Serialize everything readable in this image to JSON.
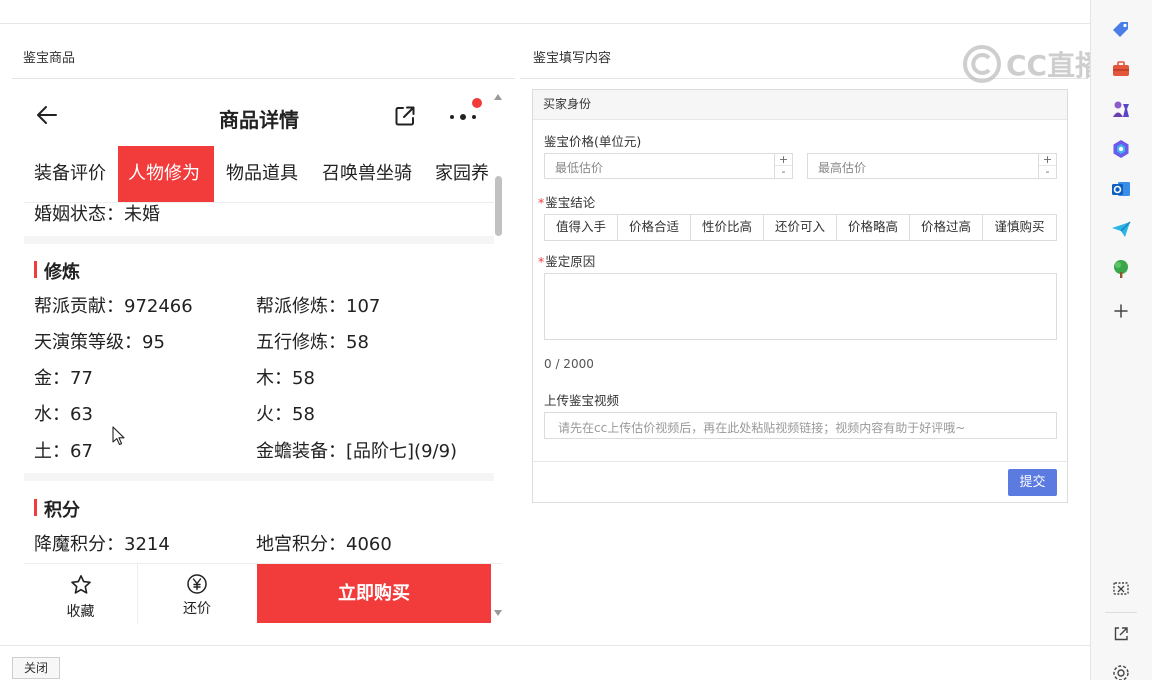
{
  "left_panel": {
    "section_title": "鉴宝商品",
    "nav": {
      "title": "商品详情"
    },
    "tabs": [
      {
        "label": "装备评价",
        "active": false
      },
      {
        "label": "人物修为",
        "active": true
      },
      {
        "label": "物品道具",
        "active": false
      },
      {
        "label": "召唤兽坐骑",
        "active": false
      },
      {
        "label": "家园养"
      }
    ],
    "marriage_status": "婚姻状态：未婚",
    "cultivation": {
      "title": "修炼",
      "rows": [
        [
          "帮派贡献：972466",
          "帮派修炼：107"
        ],
        [
          "天演策等级：95",
          "五行修炼：58"
        ],
        [
          "金：77",
          "木：58"
        ],
        [
          "水：63",
          "火：58"
        ],
        [
          "土：67",
          "金蟾装备：[品阶七](9/9)"
        ]
      ]
    },
    "points": {
      "title": "积分",
      "rows": [
        [
          "降魔积分：3214",
          "地宫积分：4060"
        ]
      ]
    },
    "bottom_bar": {
      "favorite_label": "收藏",
      "counter_offer_label": "还价",
      "buy_label": "立即购买"
    }
  },
  "right_panel": {
    "section_title": "鉴宝填写内容",
    "form_header": "买家身份",
    "price": {
      "label": "鉴宝价格(单位元)",
      "min_placeholder": "最低估价",
      "max_placeholder": "最高估价",
      "plus": "+",
      "minus": "-"
    },
    "conclusion": {
      "label": "鉴宝结论",
      "options": [
        "值得入手",
        "价格合适",
        "性价比高",
        "还价可入",
        "价格略高",
        "价格过高",
        "谨慎购买"
      ]
    },
    "reason": {
      "label": "鉴定原因",
      "counter": "0 / 2000"
    },
    "video": {
      "label": "上传鉴宝视频",
      "placeholder": "请先在cc上传估价视频后，再在此处粘贴视频链接；视频内容有助于好评哦~"
    },
    "submit_label": "提交"
  },
  "close_label": "关闭",
  "watermark": "CC直播",
  "required_mark": "*",
  "colors": {
    "accent_red": "#f23b3b",
    "submit_blue": "#5b7be0"
  }
}
